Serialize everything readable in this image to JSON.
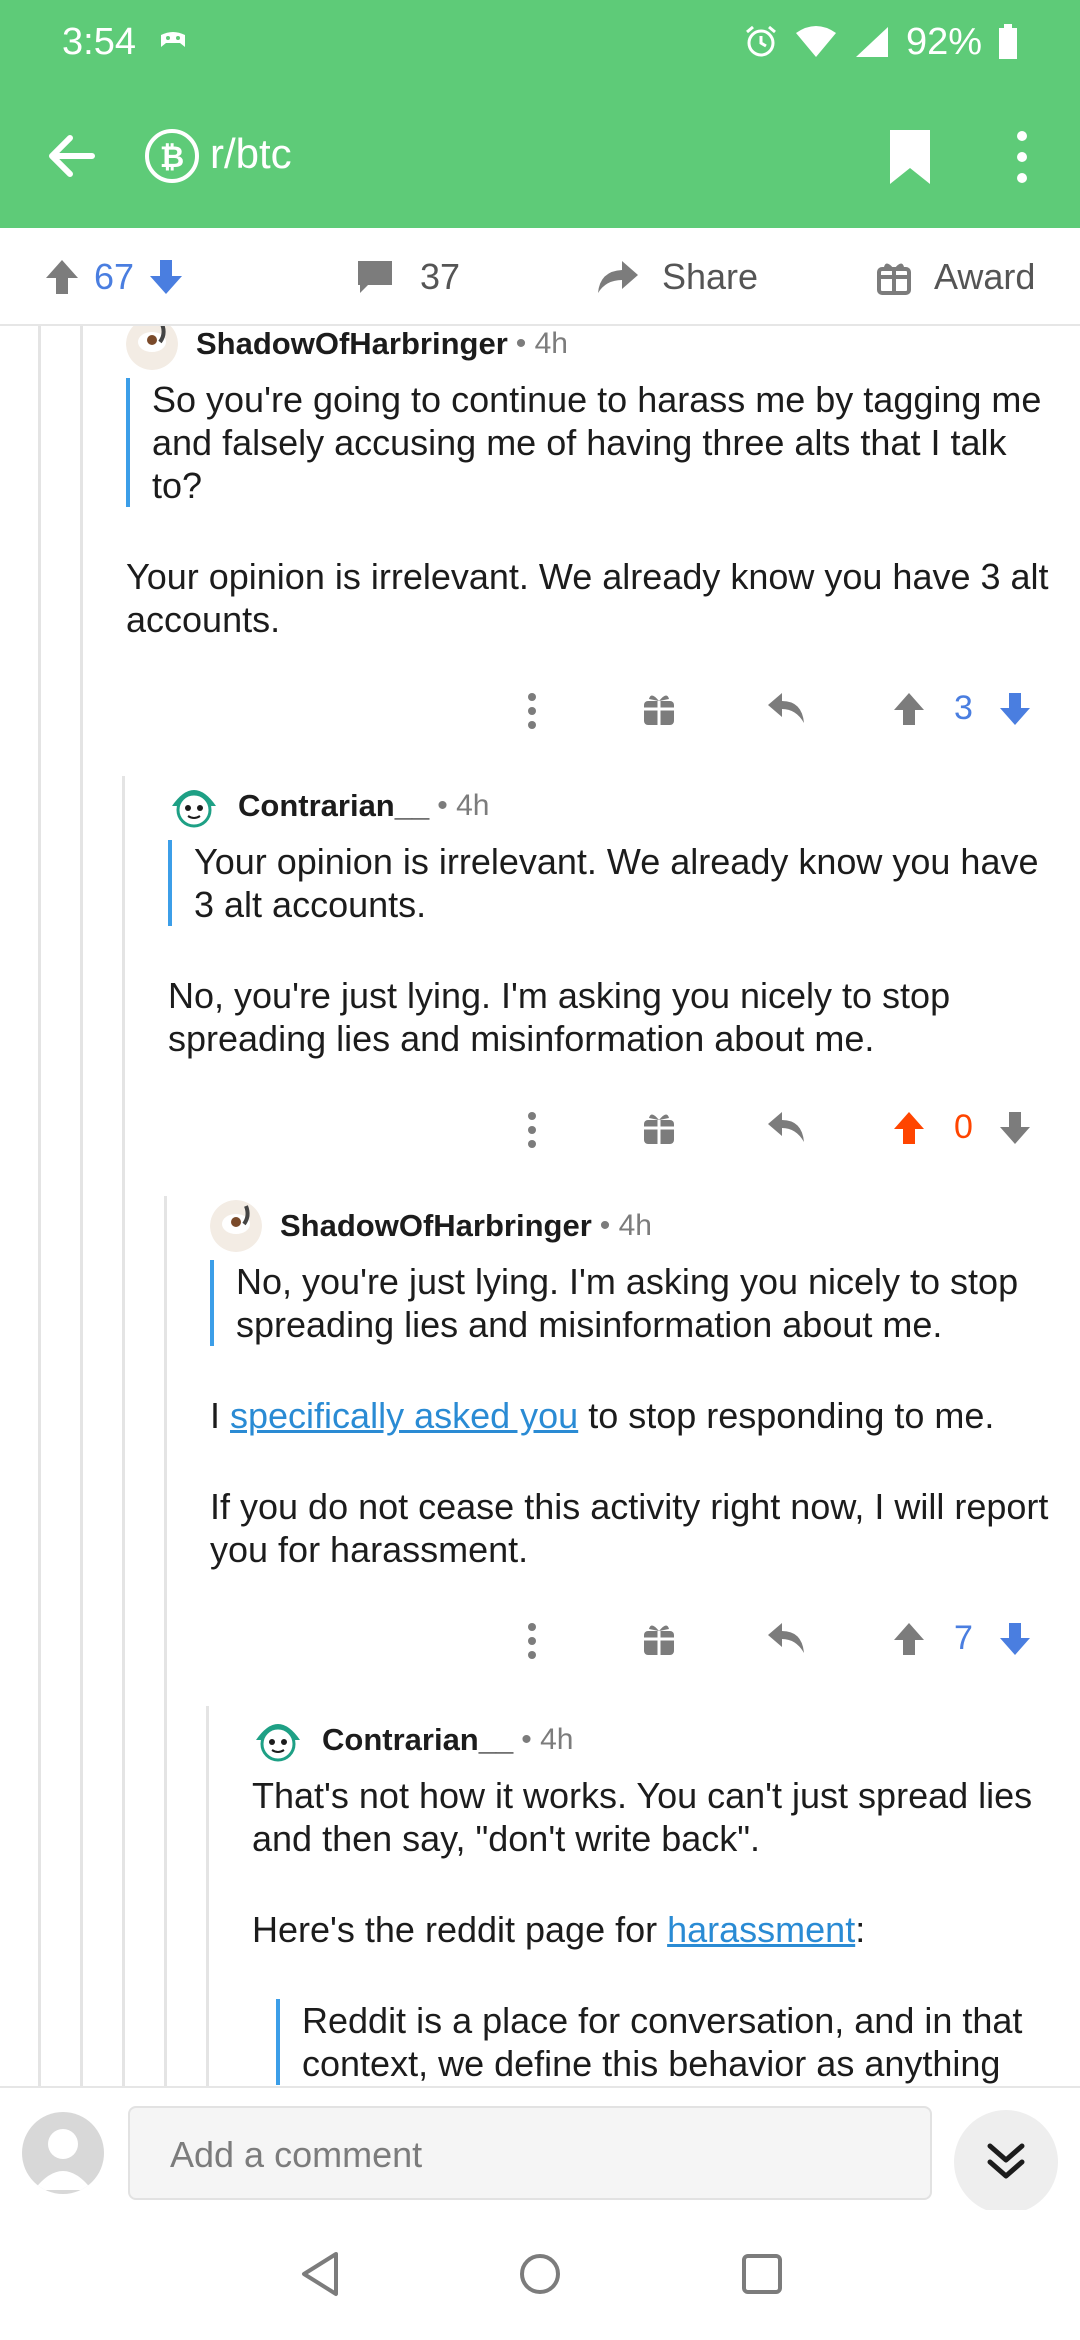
{
  "status": {
    "time": "3:54",
    "battery": "92%"
  },
  "header": {
    "subreddit": "r/btc"
  },
  "post_actions": {
    "score": "67",
    "comments": "37",
    "share": "Share",
    "award": "Award"
  },
  "comments": [
    {
      "user": "ShadowOfHarbringer",
      "age": "4h",
      "quote": "So you're going to continue to harass me by tagging me and falsely accusing me of having three alts that I talk to?",
      "body": [
        "Your opinion is irrelevant. We already know you have 3 alt accounts."
      ],
      "score": "3",
      "vote": "none"
    },
    {
      "user": "Contrarian__",
      "age": "4h",
      "quote": "Your opinion is irrelevant. We already know you have 3 alt accounts.",
      "body": [
        "No, you're just lying. I'm asking you nicely to stop spreading lies and misinformation about me."
      ],
      "score": "0",
      "vote": "up"
    },
    {
      "user": "ShadowOfHarbringer",
      "age": "4h",
      "quote": "No, you're just lying. I'm asking you nicely to stop spreading lies and misinformation about me.",
      "body_link": {
        "before": "I ",
        "link": "specifically asked you",
        "after": " to stop responding to me."
      },
      "body": [
        "If you do not cease this activity right now, I will report you for harassment."
      ],
      "score": "7",
      "vote": "none"
    },
    {
      "user": "Contrarian__",
      "age": "4h",
      "body": [
        "That's not how it works. You can't just spread lies and then say, \"don't write back\"."
      ],
      "body_link": {
        "before": "Here's the reddit page for ",
        "link": "harassment",
        "after": ":"
      },
      "quote": "Reddit is a place for conversation, and in that context, we define this behavior as anything"
    }
  ],
  "composer": {
    "placeholder": "Add a comment"
  },
  "colors": {
    "brand_green": "#5ecb78",
    "upvote_active": "#ff4500",
    "vote_blue": "#4a7ee0",
    "link": "#2a8bd4",
    "quote_bar": "#3c9ee8"
  }
}
